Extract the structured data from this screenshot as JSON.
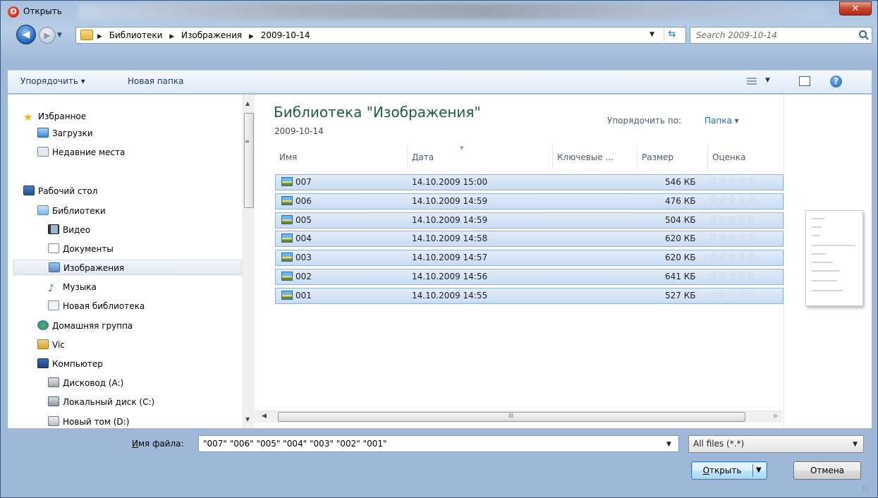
{
  "window": {
    "title": "Открыть",
    "close_glyph": "✕",
    "icon": "opera-icon"
  },
  "address": {
    "crumbs": [
      "Библиотеки",
      "Изображения",
      "2009-10-14"
    ],
    "search_placeholder": "Search 2009-10-14"
  },
  "toolbar": {
    "organize": "Упорядочить ▾",
    "new_folder": "Новая папка"
  },
  "sidebar": {
    "favorites": "Избранное",
    "downloads": "Загрузки",
    "recent": "Недавние места",
    "desktop": "Рабочий стол",
    "libraries": "Библиотеки",
    "video": "Видео",
    "documents": "Документы",
    "images": "Изображения",
    "music": "Музыка",
    "new_library": "Новая библиотека",
    "homegroup": "Домашняя группа",
    "user": "Vic",
    "computer": "Компьютер",
    "floppy": "Дисковод (A:)",
    "local_c": "Локальный диск (C:)",
    "new_d": "Новый том (D:)"
  },
  "main": {
    "library_title": "Библиотека \"Изображения\"",
    "library_sub": "2009-10-14",
    "arrange_label": "Упорядочить по:",
    "arrange_value": "Папка ▾",
    "columns": {
      "name": "Имя",
      "date": "Дата",
      "tags": "Ключевые ...",
      "size": "Размер",
      "rating": "Оценка"
    },
    "files": [
      {
        "name": "007",
        "date": "14.10.2009 15:00",
        "size": "546 КБ"
      },
      {
        "name": "006",
        "date": "14.10.2009 14:59",
        "size": "476 КБ"
      },
      {
        "name": "005",
        "date": "14.10.2009 14:59",
        "size": "504 КБ"
      },
      {
        "name": "004",
        "date": "14.10.2009 14:58",
        "size": "620 КБ"
      },
      {
        "name": "003",
        "date": "14.10.2009 14:57",
        "size": "620 КБ"
      },
      {
        "name": "002",
        "date": "14.10.2009 14:56",
        "size": "641 КБ"
      },
      {
        "name": "001",
        "date": "14.10.2009 14:55",
        "size": "527 КБ"
      }
    ],
    "stars": "☆☆☆☆☆"
  },
  "bottom": {
    "filename_label_u": "И",
    "filename_label_rest": "мя файла:",
    "filename_value": "\"007\" \"006\" \"005\" \"004\" \"003\" \"002\" \"001\"",
    "filter_value": "All files (*.*)",
    "open_u": "О",
    "open_rest": "ткрыть",
    "cancel": "Отмена"
  }
}
